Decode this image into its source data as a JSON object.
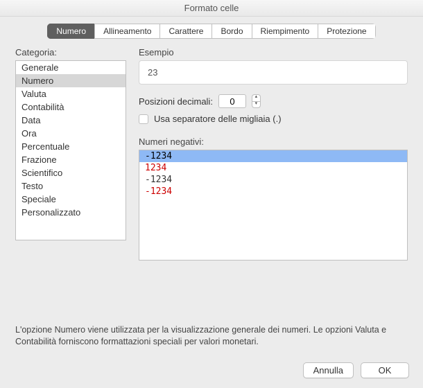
{
  "title": "Formato celle",
  "tabs": [
    "Numero",
    "Allineamento",
    "Carattere",
    "Bordo",
    "Riempimento",
    "Protezione"
  ],
  "selected_tab": 0,
  "category_label": "Categoria:",
  "categories": [
    "Generale",
    "Numero",
    "Valuta",
    "Contabilità",
    "Data",
    "Ora",
    "Percentuale",
    "Frazione",
    "Scientifico",
    "Testo",
    "Speciale",
    "Personalizzato"
  ],
  "selected_category": 1,
  "example_label": "Esempio",
  "example_value": "23",
  "decimals_label": "Posizioni decimali:",
  "decimals_value": "0",
  "thousands_label": "Usa separatore delle migliaia (.)",
  "negatives_label": "Numeri negativi:",
  "negatives": [
    {
      "text": "-1234",
      "red": false
    },
    {
      "text": "1234",
      "red": true
    },
    {
      "text": "-1234",
      "red": false
    },
    {
      "text": "-1234",
      "red": true
    }
  ],
  "selected_negative": 0,
  "footer": "L'opzione Numero viene utilizzata per la visualizzazione generale dei numeri. Le opzioni Valuta e Contabilità forniscono formattazioni speciali per valori monetari.",
  "cancel": "Annulla",
  "ok": "OK"
}
